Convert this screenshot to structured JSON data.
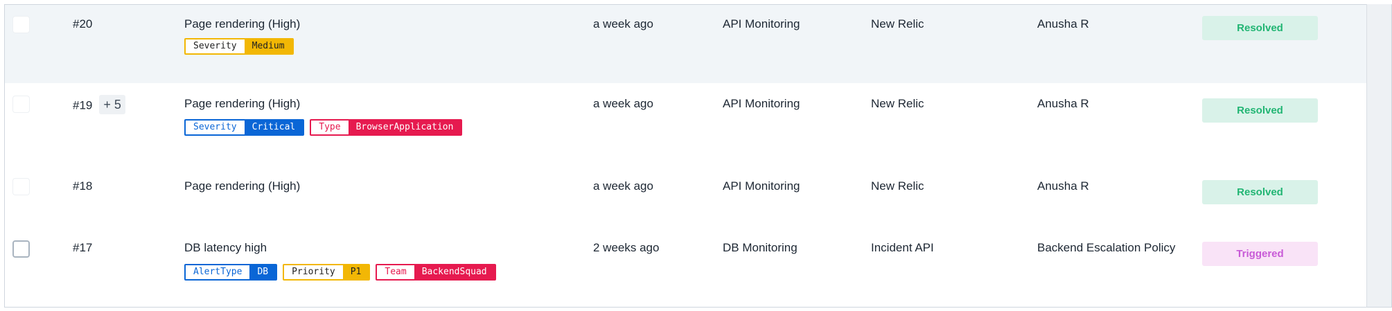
{
  "rows": [
    {
      "id": "#20",
      "more": "",
      "title": "Page rendering (High)",
      "tags": [
        {
          "key": "Severity",
          "value": "Medium",
          "color": "amber"
        }
      ],
      "time": "a week ago",
      "service": "API Monitoring",
      "source": "New Relic",
      "assignee": "Anusha R",
      "status": "Resolved",
      "highlighted": true
    },
    {
      "id": "#19",
      "more": "+ 5",
      "title": "Page rendering (High)",
      "tags": [
        {
          "key": "Severity",
          "value": "Critical",
          "color": "blue"
        },
        {
          "key": "Type",
          "value": "BrowserApplication",
          "color": "crimson"
        }
      ],
      "time": "a week ago",
      "service": "API Monitoring",
      "source": "New Relic",
      "assignee": "Anusha R",
      "status": "Resolved",
      "highlighted": false
    },
    {
      "id": "#18",
      "more": "",
      "title": "Page rendering (High)",
      "tags": [],
      "time": "a week ago",
      "service": "API Monitoring",
      "source": "New Relic",
      "assignee": "Anusha R",
      "status": "Resolved",
      "highlighted": false
    },
    {
      "id": "#17",
      "more": "",
      "title": "DB latency high",
      "tags": [
        {
          "key": "AlertType",
          "value": "DB",
          "color": "blue"
        },
        {
          "key": "Priority",
          "value": "P1",
          "color": "amber"
        },
        {
          "key": "Team",
          "value": "BackendSquad",
          "color": "crimson"
        }
      ],
      "time": "2 weeks ago",
      "service": "DB Monitoring",
      "source": "Incident API",
      "assignee": "Backend Escalation Policy",
      "status": "Triggered",
      "highlighted": false
    }
  ],
  "status_colors": {
    "Resolved": {
      "bg": "#d9f2e9",
      "fg": "#21b573"
    },
    "Triggered": {
      "bg": "#f9e3f7",
      "fg": "#c85ad7"
    }
  },
  "tag_colors": {
    "blue": "#0a66d6",
    "amber": "#f2b705",
    "crimson": "#e61a4f"
  }
}
